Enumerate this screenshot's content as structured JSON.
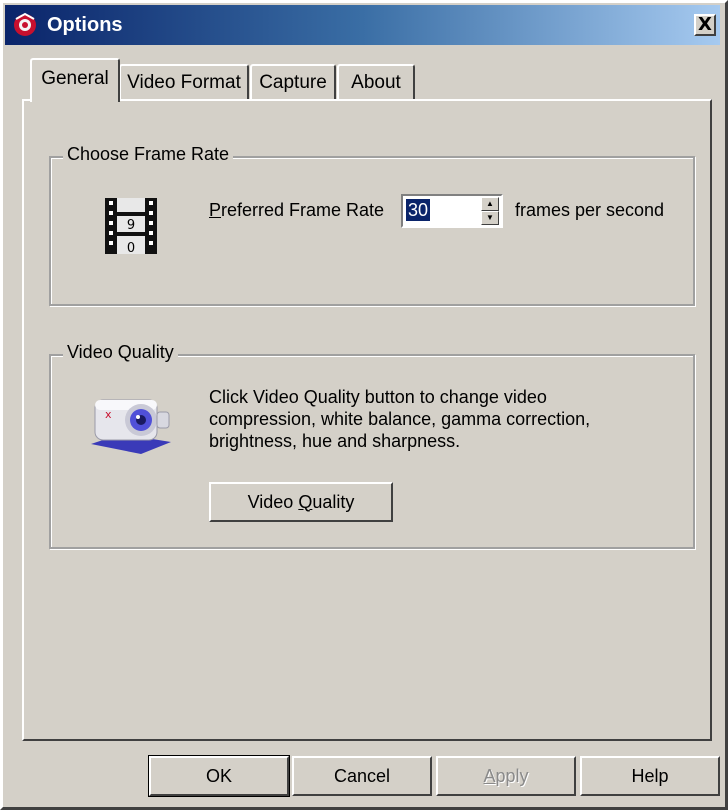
{
  "window": {
    "title": "Options",
    "close_glyph": "X",
    "icon": "app-icon"
  },
  "tabs": [
    {
      "label": "General",
      "active": true
    },
    {
      "label": "Video Format",
      "active": false
    },
    {
      "label": "Capture",
      "active": false
    },
    {
      "label": "About",
      "active": false
    }
  ],
  "frame_rate": {
    "group_title": "Choose Frame Rate",
    "label_mnemonic": "P",
    "label_rest": "referred Frame Rate",
    "value": "30",
    "unit": "frames per second",
    "icon": "film-strip-icon"
  },
  "video_quality": {
    "group_title": "Video Quality",
    "description_lines": [
      "Click Video Quality button to change video",
      "compression, white balance, gamma correction,",
      "brightness, hue and sharpness."
    ],
    "button_prefix": "Video ",
    "button_mnemonic": "Q",
    "button_rest": "uality",
    "icon": "webcam-icon"
  },
  "footer": {
    "ok": "OK",
    "cancel": "Cancel",
    "apply_mnemonic": "A",
    "apply_rest": "pply",
    "help": "Help"
  },
  "colors": {
    "face": "#d4d0c8",
    "title_start": "#0a246a",
    "title_end": "#a6caf0",
    "selection": "#0a246a"
  }
}
